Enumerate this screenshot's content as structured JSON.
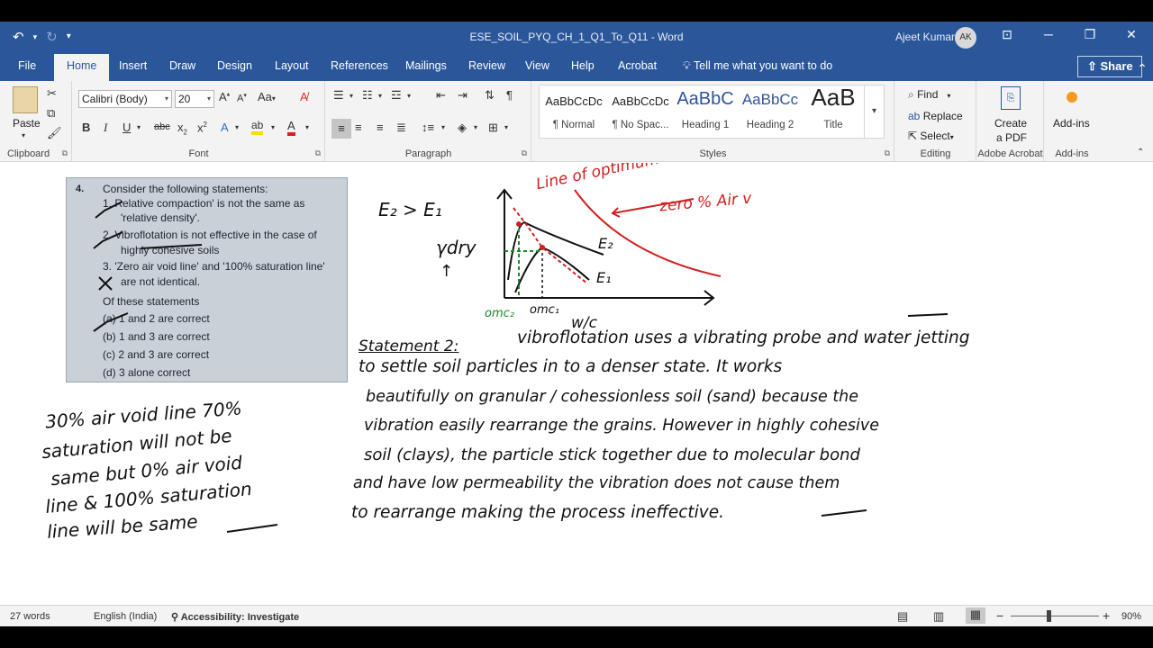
{
  "titlebar": {
    "undo_icon": "undo-icon",
    "redo_icon": "redo-icon",
    "customize_icon": "customize-icon",
    "title": "ESE_SOIL_PYQ_CH_1_Q1_To_Q11  -  Word",
    "user_name": "Ajeet Kumar",
    "avatar_initials": "AK",
    "colors": {
      "bar": "#2b579a"
    }
  },
  "tabs": [
    "File",
    "Home",
    "Insert",
    "Draw",
    "Design",
    "Layout",
    "References",
    "Mailings",
    "Review",
    "View",
    "Help",
    "Acrobat"
  ],
  "active_tab": "Home",
  "tell_me": "Tell me what you want to do",
  "share_label": "Share",
  "ribbon": {
    "clipboard": {
      "paste": "Paste",
      "label": "Clipboard"
    },
    "font": {
      "name": "Calibri (Body)",
      "size": "20",
      "label": "Font",
      "case_label": "Aa"
    },
    "paragraph": {
      "label": "Paragraph"
    },
    "styles": {
      "label": "Styles",
      "items": [
        {
          "preview": "AaBbCcDc",
          "name": "¶ Normal"
        },
        {
          "preview": "AaBbCcDc",
          "name": "¶ No Spac..."
        },
        {
          "preview": "AaBbC",
          "name": "Heading 1"
        },
        {
          "preview": "AaBbCc",
          "name": "Heading 2"
        },
        {
          "preview": "AaB",
          "name": "Title"
        }
      ]
    },
    "editing": {
      "find": "Find",
      "replace": "Replace",
      "select": "Select",
      "label": "Editing"
    },
    "acrobat": {
      "create": "Create",
      "pdf": "a PDF",
      "label": "Adobe Acrobat"
    },
    "addins": {
      "btn": "Add-ins",
      "label": "Add-ins"
    }
  },
  "question": {
    "number": "4.",
    "lines": [
      "Consider the following statements:",
      "1.  Relative compaction' is not the same as",
      "'relative density'.",
      "2.  Vibroflotation is not effective in the case of",
      "highly  cohesive soils",
      "3.  'Zero air void line' and '100% saturation line'",
      "are not identical.",
      "Of these statements",
      "(a)  1 and 2 are correct",
      "(b)  1 and 3 are correct",
      "(c)  2 and 3 are correct",
      "(d)  3 alone correct"
    ]
  },
  "handwriting": {
    "left_note": [
      "30% air void  line  70%",
      "saturation will  not be",
      "same but 0% air void",
      "line  &  100%  saturation",
      "line will  be  same"
    ],
    "graph": {
      "e_relation": "E₂ > E₁",
      "gamma": "γdry",
      "line_optimum": "Line of optimum",
      "zero_air": "zero % Air v",
      "e2": "E₂",
      "e1": "E₁",
      "omc2": "omc₂",
      "omc1": "omc₁",
      "wc": "w/c"
    },
    "statement_heading": "Statement 2:",
    "statement_lines": [
      "vibroflotation uses a vibrating probe and water jetting",
      "to settle soil particles in to a denser state. It works",
      "beautifully on granular / cohessionless soil (sand) because the",
      "vibration easily rearrange the grains. However in highly cohesive",
      "soil (clays), the particle stick together due to molecular bond",
      "and have low permeability the vibration does not cause them",
      "to rearrange making the process ineffective."
    ]
  },
  "status": {
    "words": "27 words",
    "language": "English (India)",
    "accessibility": "Accessibility: Investigate",
    "zoom": "90%",
    "zoom_level": 0.9
  }
}
